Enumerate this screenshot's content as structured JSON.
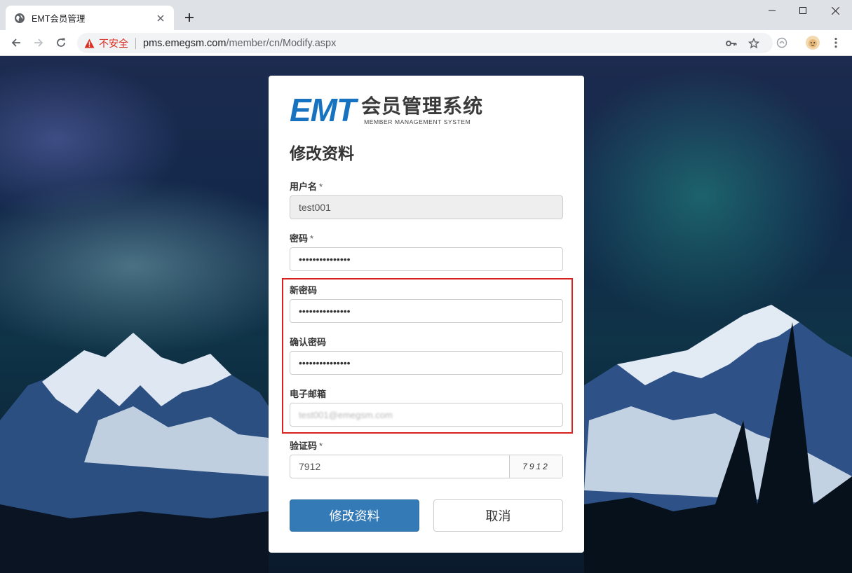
{
  "browser": {
    "tab_title": "EMT会员管理",
    "security_label": "不安全",
    "url_host": "pms.emegsm.com",
    "url_path": "/member/cn/Modify.aspx"
  },
  "logo": {
    "brand": "EMT",
    "name_cn": "会员管理系统",
    "name_en": "MEMBER MANAGEMENT SYSTEM",
    "brand_color": "#1773c0"
  },
  "form": {
    "title": "修改资料",
    "username": {
      "label": "用户名",
      "required_mark": "*",
      "value": "test001"
    },
    "password": {
      "label": "密码",
      "required_mark": "*",
      "value": "•••••••••••••••"
    },
    "new_password": {
      "label": "新密码",
      "value": "•••••••••••••••"
    },
    "confirm_password": {
      "label": "确认密码",
      "value": "•••••••••••••••"
    },
    "email": {
      "label": "电子邮箱",
      "value": "test001@emegsm.com"
    },
    "captcha": {
      "label": "验证码",
      "required_mark": "*",
      "value": "7912",
      "image_text": "7912"
    },
    "submit_label": "修改资料",
    "cancel_label": "取消"
  },
  "colors": {
    "primary_button": "#337ab7",
    "highlight_border": "#d9211f",
    "insecure_text": "#d93025"
  }
}
